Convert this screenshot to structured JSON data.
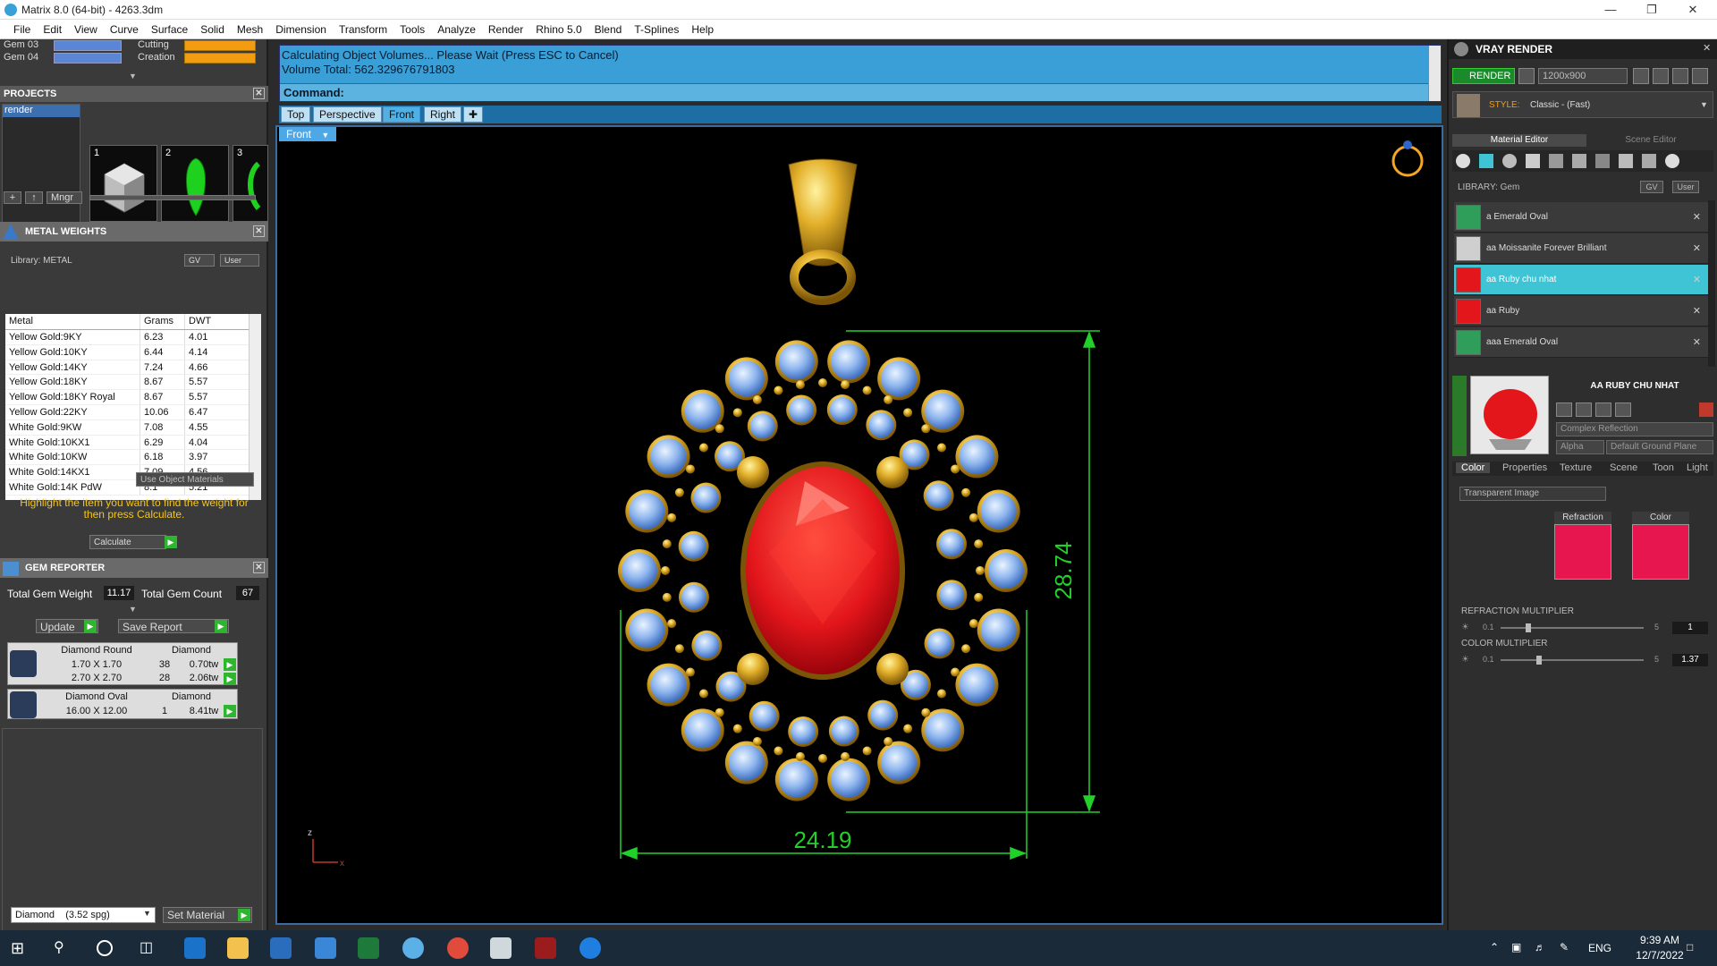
{
  "window": {
    "title": "Matrix 8.0 (64-bit) - 4263.3dm"
  },
  "menu": [
    "File",
    "Edit",
    "View",
    "Curve",
    "Surface",
    "Solid",
    "Mesh",
    "Dimension",
    "Transform",
    "Tools",
    "Analyze",
    "Render",
    "Rhino 5.0",
    "Blend",
    "T-Splines",
    "Help"
  ],
  "layers": {
    "gem03": "Gem 03",
    "gem04": "Gem 04",
    "cutting": "Cutting",
    "creation": "Creation"
  },
  "projects": {
    "title": "PROJECTS",
    "list_item": "render",
    "thumbs": [
      "1",
      "2",
      "3"
    ],
    "mngr_label": "Mngr"
  },
  "metal_weights": {
    "title": "METAL WEIGHTS",
    "library": "Library: METAL",
    "gv": "GV",
    "user": "User",
    "headers": [
      "Metal",
      "Grams",
      "DWT"
    ],
    "rows": [
      [
        "Yellow Gold:9KY",
        "6.23",
        "4.01"
      ],
      [
        "Yellow Gold:10KY",
        "6.44",
        "4.14"
      ],
      [
        "Yellow Gold:14KY",
        "7.24",
        "4.66"
      ],
      [
        "Yellow Gold:18KY",
        "8.67",
        "5.57"
      ],
      [
        "Yellow Gold:18KY Royal",
        "8.67",
        "5.57"
      ],
      [
        "Yellow Gold:22KY",
        "10.06",
        "6.47"
      ],
      [
        "White Gold:9KW",
        "7.08",
        "4.55"
      ],
      [
        "White Gold:10KX1",
        "6.29",
        "4.04"
      ],
      [
        "White Gold:10KW",
        "6.18",
        "3.97"
      ],
      [
        "White Gold:14KX1",
        "7.09",
        "4.56"
      ],
      [
        "White Gold:14K PdW",
        "8.1",
        "5.21"
      ]
    ],
    "use_object_materials": "Use Object Materials",
    "hint": "Highlight the item you want to find the weight for then press Calculate.",
    "calculate": "Calculate"
  },
  "gem_reporter": {
    "title": "GEM REPORTER",
    "total_weight_label": "Total Gem Weight",
    "total_weight": "11.17",
    "total_count_label": "Total Gem Count",
    "total_count": "67",
    "update": "Update",
    "save_report": "Save Report",
    "groups": [
      {
        "name": "Diamond Round",
        "type": "Diamond",
        "rows": [
          [
            "1.70 X 1.70",
            "38",
            "0.70tw"
          ],
          [
            "2.70 X 2.70",
            "28",
            "2.06tw"
          ]
        ]
      },
      {
        "name": "Diamond Oval",
        "type": "Diamond",
        "rows": [
          [
            "16.00 X 12.00",
            "1",
            "8.41tw"
          ]
        ]
      }
    ],
    "material_select": "Diamond    (3.52 spg)",
    "set_material": "Set Material"
  },
  "command": {
    "line1": "Calculating Object Volumes... Please Wait (Press ESC to Cancel)",
    "line2": "Volume Total: 562.329676791803",
    "prompt": "Command:"
  },
  "view_tabs": [
    "Top",
    "Perspective",
    "Front",
    "Right"
  ],
  "active_view": "Front",
  "viewport": {
    "label": "Front",
    "dim_height": "28.74",
    "dim_width": "24.19",
    "axis_z": "z",
    "axis_x": "x"
  },
  "vray": {
    "title": "VRAY RENDER",
    "render_btn": "RENDER",
    "resolution": "1200x900",
    "style_label": "STYLE:",
    "style_value": "Classic - (Fast)",
    "tabs": [
      "Material Editor",
      "Scene Editor"
    ],
    "library_label": "LIBRARY: Gem",
    "gv": "GV",
    "user": "User",
    "materials": [
      "a Emerald Oval",
      "aa Moissanite Forever Brilliant",
      "aa Ruby chu nhat",
      "aa Ruby",
      "aaa Emerald Oval"
    ],
    "selected_material": "AA RUBY CHU NHAT",
    "reflection_mode": "Complex Reflection",
    "alpha": "Alpha",
    "ground": "Default Ground Plane",
    "sub_tabs": [
      "Color",
      "Properties",
      "Texture",
      "Scene",
      "Toon",
      "Light"
    ],
    "image_mode": "Transparent Image",
    "refraction_label": "Refraction",
    "color_label": "Color",
    "refraction_multiplier_label": "REFRACTION MULTIPLIER",
    "refraction_min": "0.1",
    "refraction_max": "5",
    "refraction_value": "1",
    "color_multiplier_label": "COLOR MULTIPLIER",
    "color_min": "0.1",
    "color_max": "5",
    "color_value": "1.37"
  },
  "taskbar": {
    "lang": "ENG",
    "time": "9:39 AM",
    "date": "12/7/2022"
  },
  "colors": {
    "accent_blue": "#3a9fd6",
    "ruby": "#e3161b",
    "gold": "#d9a21f",
    "gem_blue": "#8fb6ee",
    "dim_green": "#22d02a",
    "selected_teal": "#3fc4d6"
  }
}
